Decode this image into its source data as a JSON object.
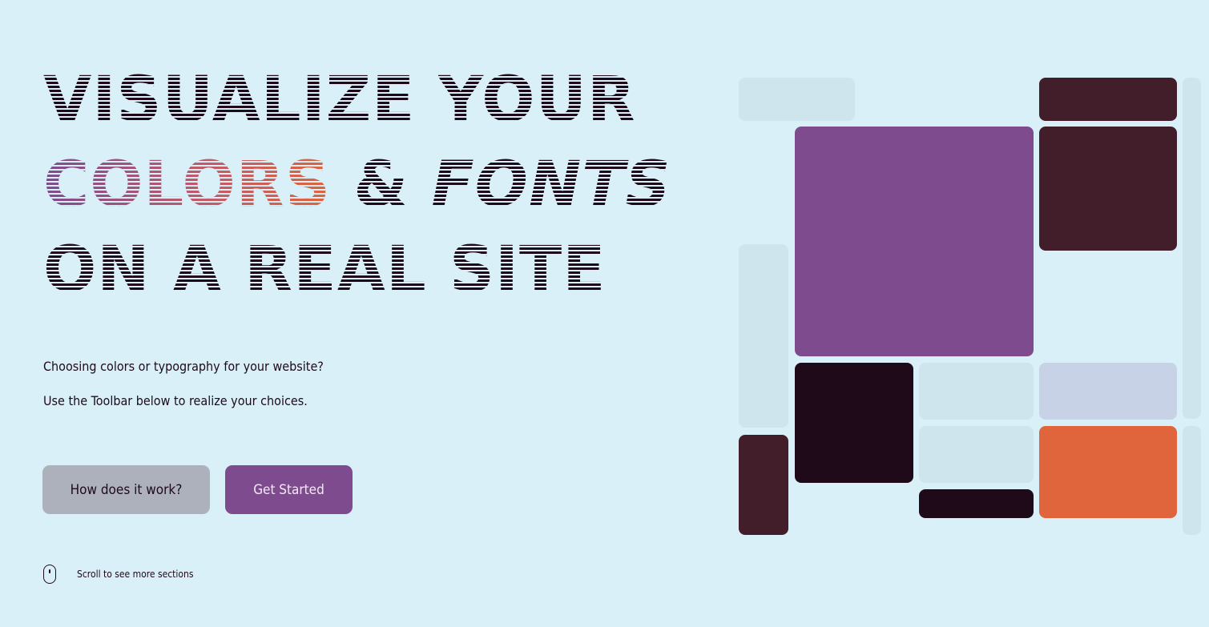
{
  "hero": {
    "headline_line1_a": "Visualize",
    "headline_line1_b": "Your",
    "headline_line2_colors": "Colors",
    "headline_line2_amp": "&",
    "headline_line2_fonts": "Fonts",
    "headline_line3_a": "On",
    "headline_line3_b": "a",
    "headline_line3_c": "Real",
    "headline_line3_d": "Site",
    "description_1": "Choosing colors or typography for your website?",
    "description_2": "Use the Toolbar below to realize your choices.",
    "secondary_button": "How does it work?",
    "primary_button": "Get Started",
    "scroll_hint": "Scroll to see more sections"
  },
  "colors": {
    "background": "#daf0f9",
    "text": "#1f0a1a",
    "primary": "#7e4c8e",
    "secondary": "#adb1bc",
    "accent": "#e0653c",
    "maroon": "#421e2a",
    "lavender": "#c8d2e6",
    "ghost": "#cfe5ee"
  },
  "icons": {
    "scroll": "mouse-icon"
  }
}
